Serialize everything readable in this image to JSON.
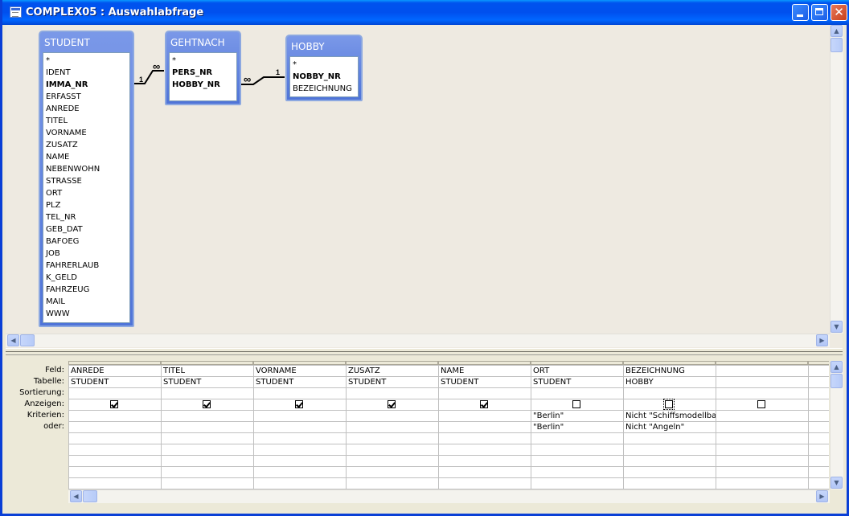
{
  "window": {
    "title": "COMPLEX05 : Auswahlabfrage"
  },
  "tables": {
    "student": {
      "title": "STUDENT",
      "fields": [
        {
          "name": "*",
          "key": false
        },
        {
          "name": "IDENT",
          "key": false
        },
        {
          "name": "IMMA_NR",
          "key": true
        },
        {
          "name": "ERFASST",
          "key": false
        },
        {
          "name": "ANREDE",
          "key": false
        },
        {
          "name": "TITEL",
          "key": false
        },
        {
          "name": "VORNAME",
          "key": false
        },
        {
          "name": "ZUSATZ",
          "key": false
        },
        {
          "name": "NAME",
          "key": false
        },
        {
          "name": "NEBENWOHN",
          "key": false
        },
        {
          "name": "STRASSE",
          "key": false
        },
        {
          "name": "ORT",
          "key": false
        },
        {
          "name": "PLZ",
          "key": false
        },
        {
          "name": "TEL_NR",
          "key": false
        },
        {
          "name": "GEB_DAT",
          "key": false
        },
        {
          "name": "BAFOEG",
          "key": false
        },
        {
          "name": "JOB",
          "key": false
        },
        {
          "name": "FAHRERLAUB",
          "key": false
        },
        {
          "name": "K_GELD",
          "key": false
        },
        {
          "name": "FAHRZEUG",
          "key": false
        },
        {
          "name": "MAIL",
          "key": false
        },
        {
          "name": "WWW",
          "key": false
        }
      ]
    },
    "gehtnach": {
      "title": "GEHTNACH",
      "fields": [
        {
          "name": "*",
          "key": false
        },
        {
          "name": "PERS_NR",
          "key": true
        },
        {
          "name": "HOBBY_NR",
          "key": true
        }
      ]
    },
    "hobby": {
      "title": "HOBBY",
      "fields": [
        {
          "name": "*",
          "key": false
        },
        {
          "name": "NOBBY_NR",
          "key": true
        },
        {
          "name": "BEZEICHNUNG",
          "key": false
        }
      ]
    }
  },
  "relations": [
    {
      "one_label": "1",
      "many_label": "∞"
    },
    {
      "one_label": "1",
      "many_label": "∞"
    }
  ],
  "grid": {
    "row_labels": [
      "Feld:",
      "Tabelle:",
      "Sortierung:",
      "Anzeigen:",
      "Kriterien:",
      "oder:"
    ],
    "columns": [
      {
        "field": "ANREDE",
        "table": "STUDENT",
        "sort": "",
        "show": true,
        "criteria": "",
        "or": ""
      },
      {
        "field": "TITEL",
        "table": "STUDENT",
        "sort": "",
        "show": true,
        "criteria": "",
        "or": ""
      },
      {
        "field": "VORNAME",
        "table": "STUDENT",
        "sort": "",
        "show": true,
        "criteria": "",
        "or": ""
      },
      {
        "field": "ZUSATZ",
        "table": "STUDENT",
        "sort": "",
        "show": true,
        "criteria": "",
        "or": ""
      },
      {
        "field": "NAME",
        "table": "STUDENT",
        "sort": "",
        "show": true,
        "criteria": "",
        "or": ""
      },
      {
        "field": "ORT",
        "table": "STUDENT",
        "sort": "",
        "show": false,
        "criteria": "\"Berlin\"",
        "or": "\"Berlin\""
      },
      {
        "field": "BEZEICHNUNG",
        "table": "HOBBY",
        "sort": "",
        "show": false,
        "criteria": "Nicht \"Schiffsmodellbau",
        "or": "Nicht \"Angeln\""
      },
      {
        "field": "",
        "table": "",
        "sort": "",
        "show": false,
        "criteria": "",
        "or": ""
      }
    ]
  },
  "colors": {
    "titlebar": "#0053ee",
    "table_header": "#5b7fdc",
    "background": "#ece9d8"
  }
}
